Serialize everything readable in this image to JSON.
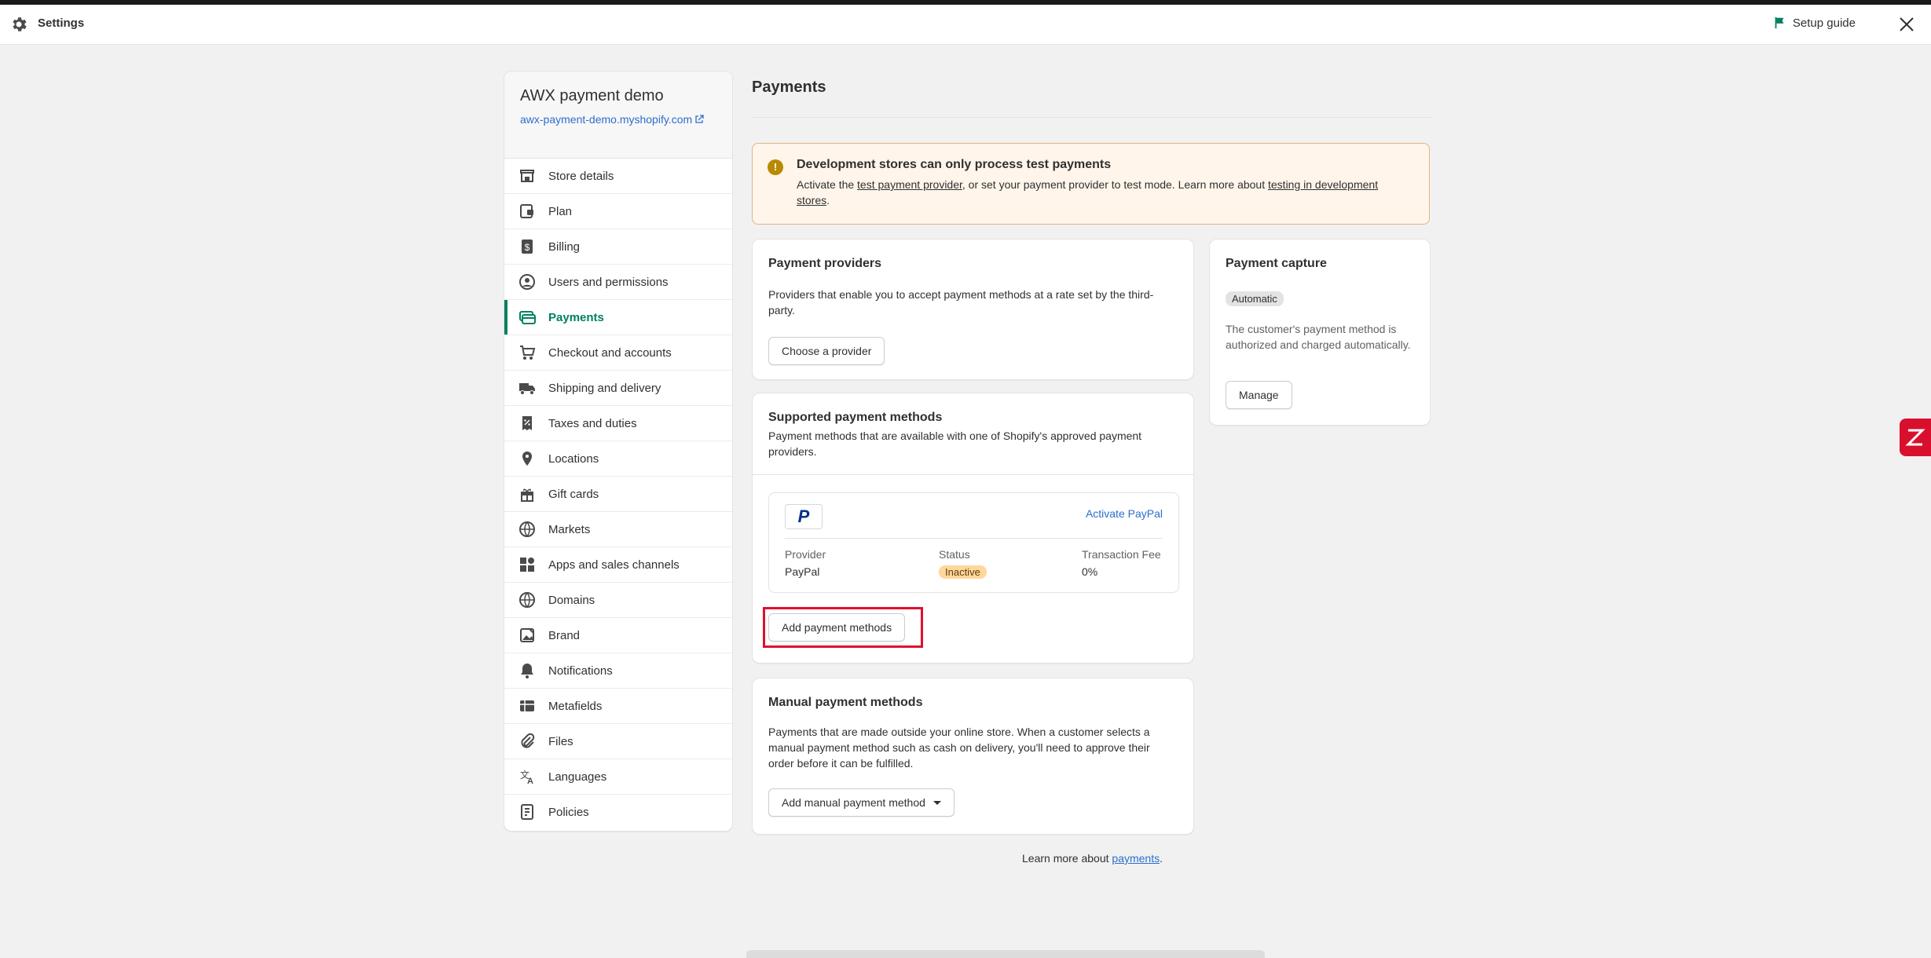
{
  "topbar": {
    "title": "Settings",
    "setup_guide": "Setup guide"
  },
  "store": {
    "name": "AWX payment demo",
    "url": "awx-payment-demo.myshopify.com"
  },
  "sidebar": {
    "items": [
      {
        "label": "Store details",
        "icon": "store-icon"
      },
      {
        "label": "Plan",
        "icon": "plan-icon"
      },
      {
        "label": "Billing",
        "icon": "billing-icon"
      },
      {
        "label": "Users and permissions",
        "icon": "user-icon"
      },
      {
        "label": "Payments",
        "icon": "payments-icon",
        "active": true
      },
      {
        "label": "Checkout and accounts",
        "icon": "cart-icon"
      },
      {
        "label": "Shipping and delivery",
        "icon": "truck-icon"
      },
      {
        "label": "Taxes and duties",
        "icon": "tax-icon"
      },
      {
        "label": "Locations",
        "icon": "location-pin-icon"
      },
      {
        "label": "Gift cards",
        "icon": "gift-icon"
      },
      {
        "label": "Markets",
        "icon": "globe-icon"
      },
      {
        "label": "Apps and sales channels",
        "icon": "apps-icon"
      },
      {
        "label": "Domains",
        "icon": "domain-globe-icon"
      },
      {
        "label": "Brand",
        "icon": "brand-icon"
      },
      {
        "label": "Notifications",
        "icon": "bell-icon"
      },
      {
        "label": "Metafields",
        "icon": "metafields-icon"
      },
      {
        "label": "Files",
        "icon": "paperclip-icon"
      },
      {
        "label": "Languages",
        "icon": "language-icon"
      },
      {
        "label": "Policies",
        "icon": "policy-icon"
      }
    ]
  },
  "main": {
    "title": "Payments",
    "banner": {
      "title": "Development stores can only process test payments",
      "text_1": "Activate the ",
      "link_1": "test payment provider",
      "text_2": ", or set your payment provider to test mode. Learn more about ",
      "link_2": "testing in development stores",
      "text_3": "."
    },
    "providers": {
      "title": "Payment providers",
      "description": "Providers that enable you to accept payment methods at a rate set by the third-party.",
      "button": "Choose a provider"
    },
    "capture": {
      "title": "Payment capture",
      "badge": "Automatic",
      "description": "The customer's payment method is authorized and charged automatically.",
      "button": "Manage"
    },
    "supported": {
      "title": "Supported payment methods",
      "description": "Payment methods that are available with one of Shopify's approved payment providers.",
      "activate_link": "Activate PayPal",
      "logo_text": "P",
      "provider_label": "Provider",
      "provider_value": "PayPal",
      "status_label": "Status",
      "status_value": "Inactive",
      "fee_label": "Transaction Fee",
      "fee_value": "0%",
      "button": "Add payment methods"
    },
    "manual": {
      "title": "Manual payment methods",
      "description": "Payments that are made outside your online store. When a customer selects a manual payment method such as cash on delivery, you'll need to approve their order before it can be fulfilled.",
      "button": "Add manual payment method"
    },
    "learn_more": {
      "text": "Learn more about ",
      "link": "payments",
      "suffix": "."
    }
  },
  "colors": {
    "accent": "#008060",
    "link": "#2c6ecb",
    "highlight": "#e0102e",
    "warning_bg": "#fff5ea"
  }
}
